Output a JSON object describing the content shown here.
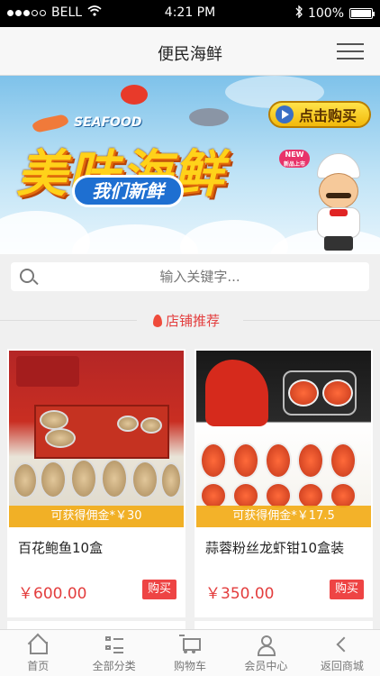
{
  "status": {
    "carrier": "BELL",
    "time": "4:21 PM",
    "battery": "100%",
    "signal_bars_filled": 3,
    "signal_bars_total": 5
  },
  "header": {
    "title": "便民海鲜",
    "menu_icon": "menu-icon"
  },
  "banner": {
    "seafood_word": "SEAFOOD",
    "title": "美味海鲜",
    "subtitle": "我们新鲜",
    "buy_label": "点击购买",
    "new_badge": "NEW",
    "new_badge_sub": "新品上市"
  },
  "search": {
    "placeholder": "输入关键字..."
  },
  "section": {
    "label": "店铺推荐"
  },
  "products": [
    {
      "name": "百花鲍鱼10盒",
      "commission": "可获得佣金*￥30",
      "price": "￥600.00",
      "buy_label": "购买"
    },
    {
      "name": "蒜蓉粉丝龙虾钳10盒装",
      "commission": "可获得佣金*￥17.5",
      "price": "￥350.00",
      "buy_label": "购买"
    }
  ],
  "tabbar": {
    "items": [
      {
        "label": "首页",
        "icon": "home-icon"
      },
      {
        "label": "全部分类",
        "icon": "category-icon"
      },
      {
        "label": "购物车",
        "icon": "cart-icon"
      },
      {
        "label": "会员中心",
        "icon": "user-icon"
      },
      {
        "label": "返回商城",
        "icon": "back-icon"
      }
    ]
  },
  "colors": {
    "accent": "#e33d3d",
    "commission_bg": "#f2ac18",
    "buy_button": "#ee4444"
  }
}
